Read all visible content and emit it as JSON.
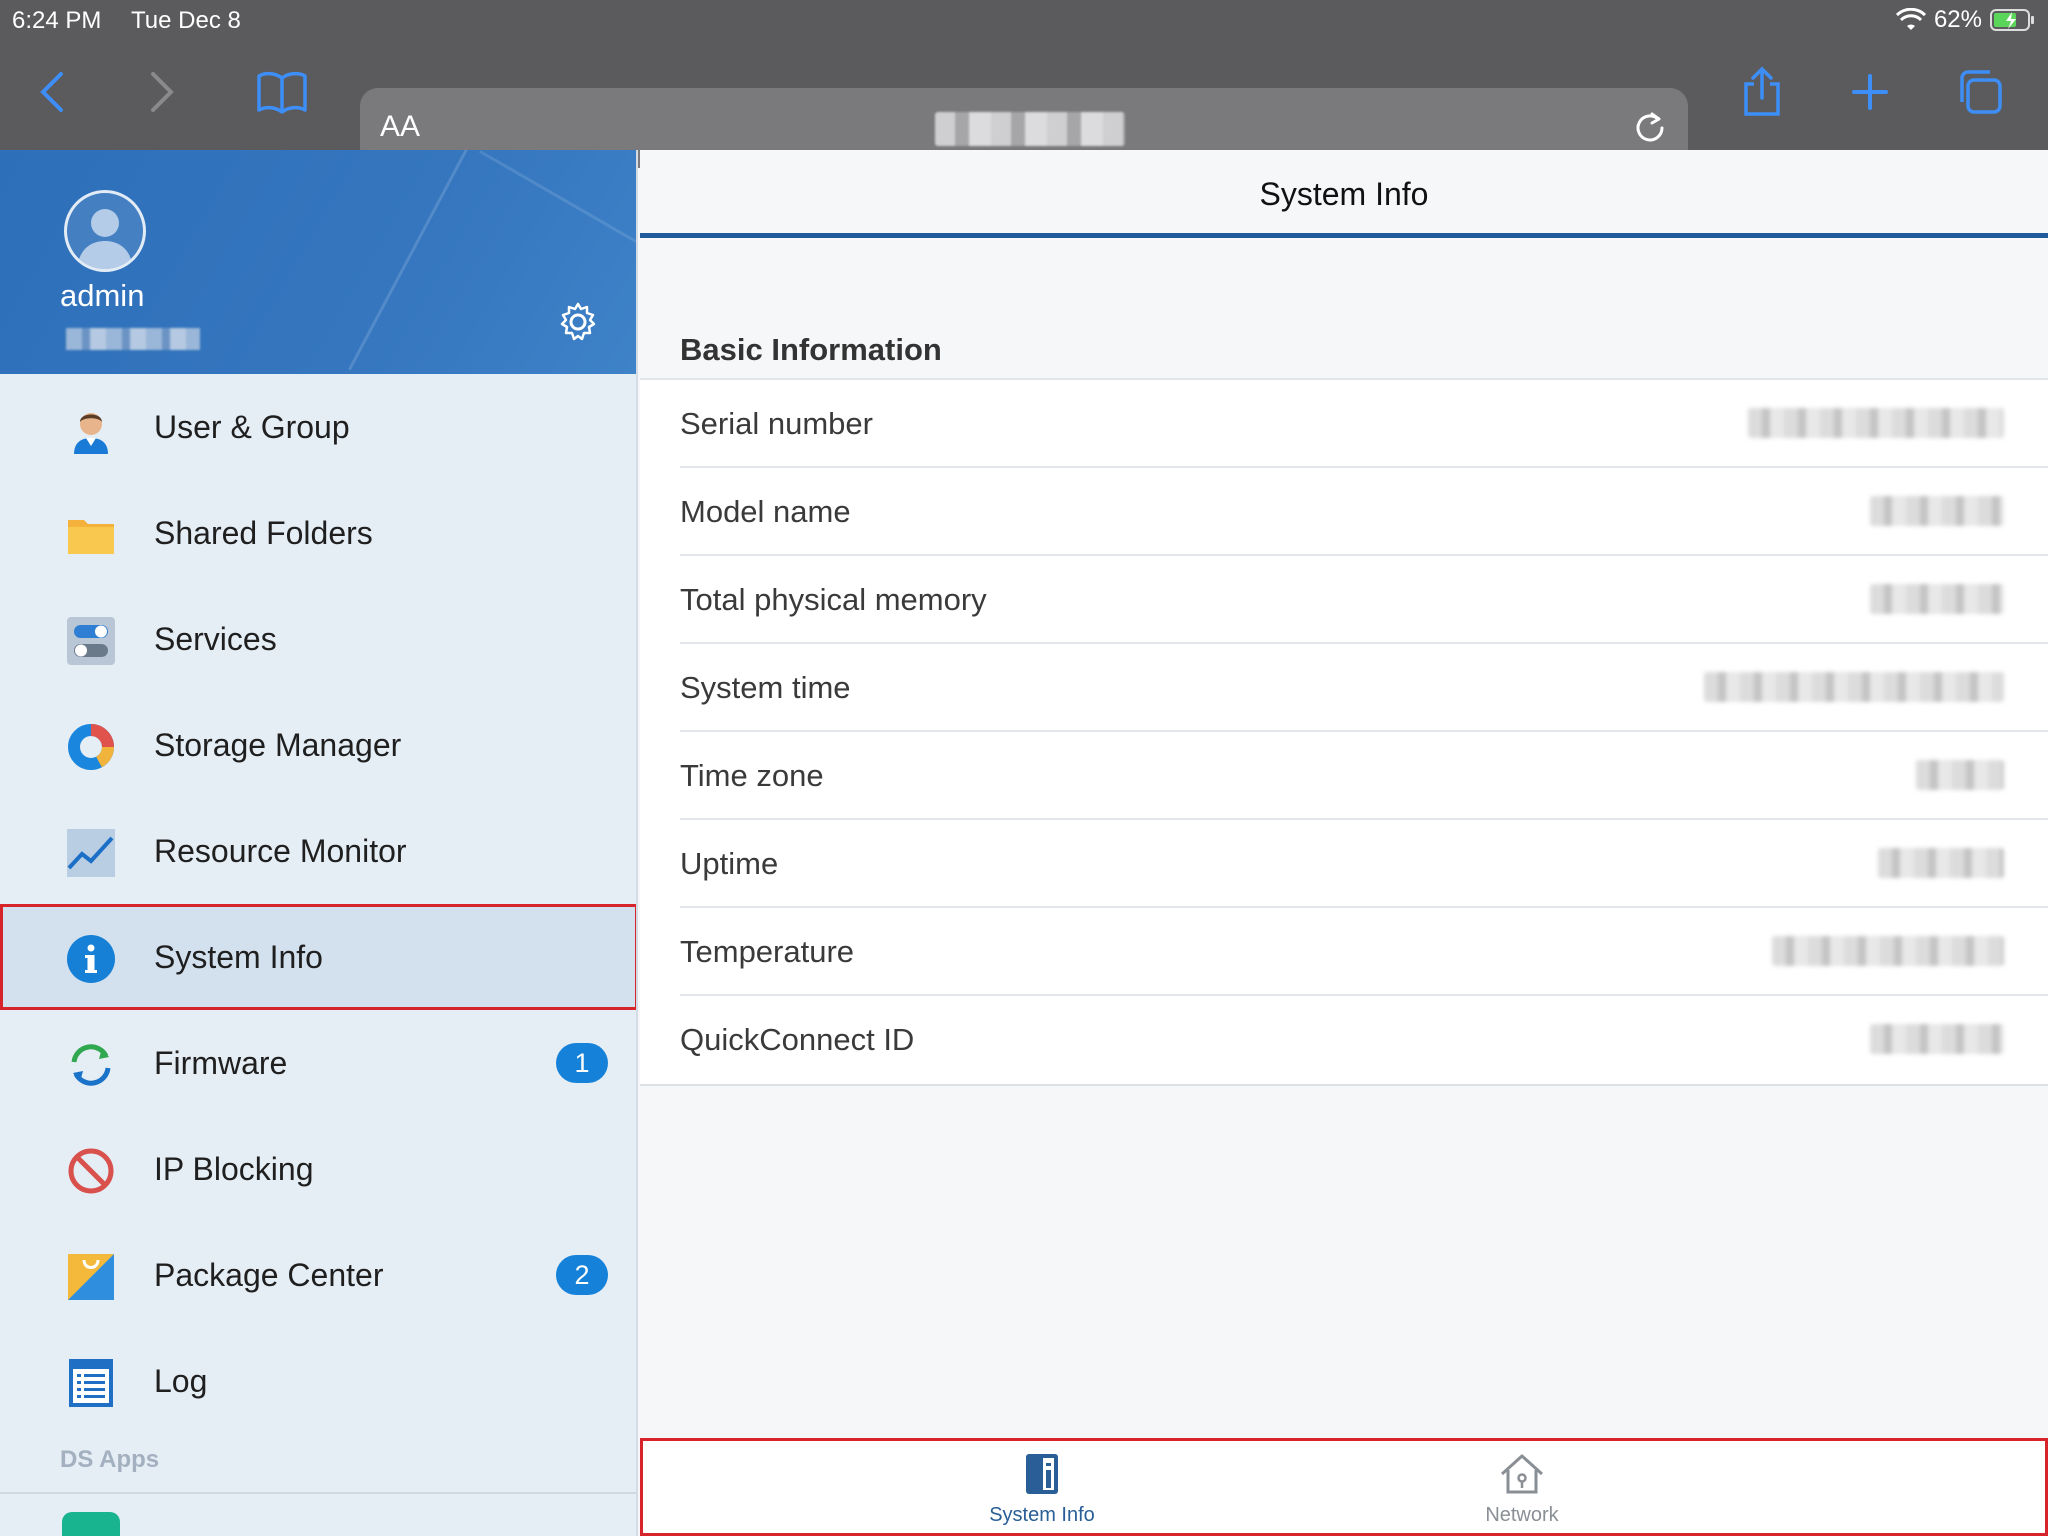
{
  "status_bar": {
    "time": "6:24 PM",
    "date": "Tue Dec 8",
    "battery": "62%"
  },
  "browser": {
    "text_size_button": "AA",
    "icons": [
      "back-icon",
      "forward-icon",
      "bookmarks-icon",
      "reload-icon",
      "share-icon",
      "new-tab-icon",
      "tabs-icon"
    ]
  },
  "profile": {
    "username": "admin"
  },
  "sidebar": {
    "items": [
      {
        "label": "User & Group",
        "icon": "user-group-icon"
      },
      {
        "label": "Shared Folders",
        "icon": "folder-icon"
      },
      {
        "label": "Services",
        "icon": "services-toggle-icon"
      },
      {
        "label": "Storage Manager",
        "icon": "storage-donut-icon"
      },
      {
        "label": "Resource Monitor",
        "icon": "resource-chart-icon"
      },
      {
        "label": "System Info",
        "icon": "info-icon"
      },
      {
        "label": "Firmware",
        "icon": "firmware-refresh-icon",
        "badge": "1"
      },
      {
        "label": "IP Blocking",
        "icon": "block-icon"
      },
      {
        "label": "Package Center",
        "icon": "package-bag-icon",
        "badge": "2"
      },
      {
        "label": "Log",
        "icon": "log-list-icon"
      }
    ],
    "section_title": "DS Apps"
  },
  "main": {
    "title": "System Info",
    "section_title": "Basic Information",
    "rows": [
      {
        "label": "Serial number"
      },
      {
        "label": "Model name"
      },
      {
        "label": "Total physical memory"
      },
      {
        "label": "System time"
      },
      {
        "label": "Time zone"
      },
      {
        "label": "Uptime"
      },
      {
        "label": "Temperature"
      },
      {
        "label": "QuickConnect ID"
      }
    ]
  },
  "tabs": [
    {
      "label": "System Info",
      "icon": "system-info-tab-icon",
      "selected": true
    },
    {
      "label": "Network",
      "icon": "network-house-icon",
      "selected": false
    }
  ],
  "colors": {
    "accent": "#1f5b9c",
    "badge": "#1581d8",
    "highlight": "#d7242b",
    "tab_selected": "#2a5e96",
    "tab_unselected": "#8a8f96"
  }
}
